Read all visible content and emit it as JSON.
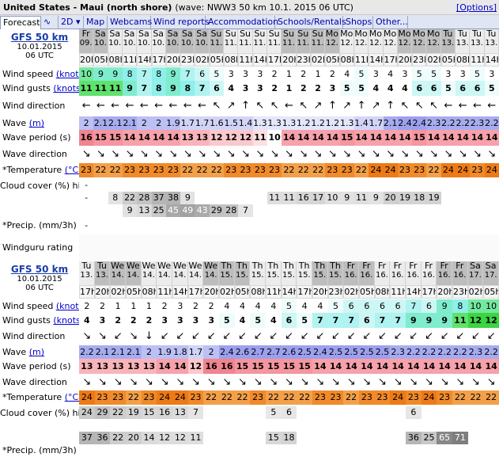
{
  "title": {
    "location": "United States - Maui (north shore)",
    "wave_info": "(wave: NWW3 50 km 10.1. 2015 06 UTC)",
    "options": "[Options]"
  },
  "tabs": [
    {
      "label": "Forecast"
    },
    {
      "label": "∿"
    },
    {
      "label": "2D ▾"
    },
    {
      "label": "Map"
    },
    {
      "label": "Webcams"
    },
    {
      "label": "Wind reports"
    },
    {
      "label": "Accommodation"
    },
    {
      "label": "Schools/Rentals"
    },
    {
      "label": "Shops"
    },
    {
      "label": "Other..."
    }
  ],
  "labels": {
    "wind_speed": "Wind speed",
    "wind_gusts": "Wind gusts",
    "knots": "(knots)",
    "wind_direction": "Wind direction",
    "wave": "Wave",
    "m": "(m)",
    "wave_period": "Wave period (s)",
    "wave_direction": "Wave direction",
    "temperature": "*Temperature",
    "celsius": "(°C)",
    "cloud_cover": "Cloud cover (%) high / mid / low",
    "precip": "*Precip. (mm/3h)",
    "rating": "Windguru rating"
  },
  "model": {
    "name": "GFS 50 km",
    "date": "10.01.2015",
    "time": "06 UTC"
  },
  "block1": {
    "days": [
      "Fr",
      "Sa",
      "Sa",
      "Sa",
      "Sa",
      "Sa",
      "Sa",
      "Sa",
      "Sa",
      "Su",
      "Su",
      "Su",
      "Su",
      "Su",
      "Su",
      "Su",
      "Su",
      "Mo",
      "Mo",
      "Mo",
      "Mo",
      "Mo",
      "Mo",
      "Mo",
      "Mo",
      "Tu",
      "Tu",
      "Tu",
      "Tu"
    ],
    "dates": [
      "09.",
      "10.",
      "10.",
      "10.",
      "10.",
      "10.",
      "10.",
      "10.",
      "10.",
      "11.",
      "11.",
      "11.",
      "11.",
      "11.",
      "11.",
      "11.",
      "11.",
      "12.",
      "12.",
      "12.",
      "12.",
      "12.",
      "12.",
      "12.",
      "12.",
      "13.",
      "13.",
      "13.",
      "13."
    ],
    "hours": [
      "20h",
      "05h",
      "08h",
      "11h",
      "14h",
      "17h",
      "20h",
      "23h",
      "02h",
      "05h",
      "08h",
      "11h",
      "14h",
      "17h",
      "20h",
      "23h",
      "02h",
      "05h",
      "08h",
      "11h",
      "14h",
      "17h",
      "20h",
      "23h",
      "02h",
      "05h",
      "08h",
      "11h",
      "14h"
    ],
    "wind_speed": [
      "10",
      "9",
      "9",
      "8",
      "7",
      "8",
      "9",
      "7",
      "6",
      "5",
      "3",
      "3",
      "3",
      "2",
      "1",
      "2",
      "1",
      "2",
      "4",
      "5",
      "3",
      "4",
      "3",
      "5",
      "5",
      "3",
      "3",
      "5",
      "3"
    ],
    "wind_gusts": [
      "11",
      "11",
      "11",
      "9",
      "7",
      "8",
      "9",
      "8",
      "7",
      "6",
      "4",
      "3",
      "3",
      "2",
      "1",
      "2",
      "2",
      "3",
      "5",
      "5",
      "4",
      "4",
      "4",
      "6",
      "6",
      "5",
      "6",
      "6",
      "5"
    ],
    "wind_dir": [
      "←",
      "←",
      "←",
      "←",
      "←",
      "←",
      "←",
      "←",
      "←",
      "↖",
      "↗",
      "↑",
      "↖",
      "↖",
      "←",
      "↖",
      "↗",
      "↑",
      "↗",
      "↑",
      "↗",
      "↑",
      "↖",
      "↖",
      "↖",
      "←",
      "←",
      "←",
      "←"
    ],
    "wave": [
      "2",
      "2.1",
      "2.1",
      "2.1",
      "2",
      "2",
      "1.9",
      "1.7",
      "1.7",
      "1.6",
      "1.5",
      "1.4",
      "1.3",
      "1.3",
      "1.3",
      "1.2",
      "1.2",
      "1.2",
      "1.3",
      "1.4",
      "1.7",
      "2.1",
      "2.4",
      "2.4",
      "2.3",
      "2.2",
      "2.2",
      "2.3",
      "2.2"
    ],
    "wave_period": [
      "16",
      "15",
      "15",
      "14",
      "14",
      "14",
      "14",
      "13",
      "13",
      "12",
      "12",
      "12",
      "11",
      "10",
      "14",
      "14",
      "14",
      "14",
      "15",
      "14",
      "14",
      "14",
      "14",
      "15",
      "14",
      "14",
      "14",
      "14",
      "14"
    ],
    "wave_dir": [
      "↘",
      "↘",
      "↘",
      "↘",
      "↘",
      "↘",
      "↘",
      "↘",
      "↘",
      "↘",
      "↘",
      "↘",
      "↘",
      "↘",
      "↘",
      "↘",
      "↘",
      "↘",
      "↘",
      "↘",
      "↘",
      "↘",
      "↘",
      "↘",
      "↘",
      "↘",
      "↘",
      "↘",
      "↘"
    ],
    "temp": [
      "23",
      "22",
      "22",
      "23",
      "23",
      "23",
      "23",
      "22",
      "22",
      "22",
      "23",
      "23",
      "23",
      "23",
      "22",
      "22",
      "22",
      "23",
      "23",
      "22",
      "24",
      "24",
      "23",
      "23",
      "22",
      "24",
      "24",
      "23",
      "24"
    ],
    "cloud_high": [
      "-",
      "",
      "",
      "",
      "",
      "",
      "",
      "",
      "",
      "",
      "",
      "",
      "",
      "",
      "",
      "",
      "",
      "",
      "",
      "",
      "",
      "",
      "",
      "",
      "",
      "",
      "",
      "",
      ""
    ],
    "cloud_mid": [
      "-",
      "",
      "8",
      "22",
      "28",
      "37",
      "38",
      "9",
      "",
      "",
      "",
      "",
      "",
      "11",
      "11",
      "16",
      "17",
      "10",
      "9",
      "11",
      "9",
      "20",
      "19",
      "18",
      "19",
      "",
      "",
      "",
      ""
    ],
    "cloud_low": [
      "",
      "",
      "",
      "9",
      "13",
      "25",
      "45",
      "49",
      "43",
      "29",
      "28",
      "7",
      "",
      "",
      "",
      "",
      "",
      "",
      "",
      "",
      "",
      "",
      "",
      "",
      "",
      "",
      "",
      "",
      ""
    ],
    "precip": [
      "-",
      "",
      "",
      "",
      "",
      "",
      "",
      "",
      "",
      "",
      "",
      "",
      "",
      "",
      "",
      "",
      "",
      "",
      "",
      "",
      "",
      "",
      "",
      "",
      "",
      "",
      "",
      "",
      ""
    ]
  },
  "block2": {
    "days": [
      "Tu",
      "Tu",
      "We",
      "We",
      "We",
      "We",
      "We",
      "We",
      "We",
      "Th",
      "Th",
      "Th",
      "Th",
      "Th",
      "Th",
      "Th",
      "Th",
      "Fr",
      "Fr",
      "Fr",
      "Fr",
      "Fr",
      "Fr",
      "Fr",
      "Fr",
      "Sa",
      "Sa"
    ],
    "dates": [
      "13.",
      "13.",
      "14.",
      "14.",
      "14.",
      "14.",
      "14.",
      "14.",
      "14.",
      "15.",
      "15.",
      "15.",
      "15.",
      "15.",
      "15.",
      "15.",
      "15.",
      "16.",
      "16.",
      "16.",
      "16.",
      "16.",
      "16.",
      "16.",
      "16.",
      "17.",
      "17."
    ],
    "hours": [
      "17h",
      "20h",
      "02h",
      "05h",
      "08h",
      "11h",
      "14h",
      "17h",
      "20h",
      "02h",
      "05h",
      "08h",
      "11h",
      "14h",
      "17h",
      "20h",
      "23h",
      "02h",
      "05h",
      "08h",
      "11h",
      "14h",
      "17h",
      "20h",
      "23h",
      "02h",
      "05h"
    ],
    "wind_speed": [
      "2",
      "2",
      "1",
      "1",
      "1",
      "2",
      "3",
      "2",
      "2",
      "4",
      "4",
      "4",
      "4",
      "5",
      "4",
      "4",
      "5",
      "6",
      "6",
      "6",
      "6",
      "7",
      "6",
      "9",
      "8",
      "10",
      "10"
    ],
    "wind_gusts": [
      "4",
      "3",
      "2",
      "2",
      "2",
      "3",
      "3",
      "3",
      "3",
      "5",
      "4",
      "5",
      "4",
      "6",
      "5",
      "7",
      "7",
      "7",
      "6",
      "7",
      "7",
      "9",
      "9",
      "9",
      "11",
      "12",
      "12"
    ],
    "wind_dir": [
      "↘",
      "↘",
      "↙",
      "↘",
      "↓",
      "↙",
      "↙",
      "↙",
      "↙",
      "↙",
      "↙",
      "↙",
      "↙",
      "↙",
      "↙",
      "↙",
      "↙",
      "↙",
      "↙",
      "↙",
      "↙",
      "↙",
      "↙",
      "↙",
      "↙",
      "↙",
      "↙"
    ],
    "wave": [
      "2.2",
      "2.1",
      "2.1",
      "2.1",
      "2",
      "1.9",
      "1.8",
      "1.7",
      "2",
      "2.4",
      "2.6",
      "2.7",
      "2.7",
      "2.6",
      "2.5",
      "2.4",
      "2.5",
      "2.5",
      "2.5",
      "2.5",
      "2.3",
      "2.2",
      "2.2",
      "2.2",
      "2.2",
      "2.3",
      "2.2"
    ],
    "wave_period": [
      "13",
      "13",
      "13",
      "13",
      "13",
      "14",
      "14",
      "12",
      "16",
      "16",
      "15",
      "15",
      "15",
      "15",
      "15",
      "14",
      "14",
      "14",
      "14",
      "14",
      "14",
      "14",
      "14",
      "14",
      "14",
      "14",
      "14"
    ],
    "wave_dir": [
      "↘",
      "↘",
      "↘",
      "↘",
      "↘",
      "↘",
      "↘",
      "↘",
      "↘",
      "↘",
      "↘",
      "↘",
      "↘",
      "↘",
      "↘",
      "↘",
      "↘",
      "↘",
      "↘",
      "↘",
      "↘",
      "↘",
      "↘",
      "↘",
      "↘",
      "↘",
      "↘"
    ],
    "temp": [
      "24",
      "23",
      "23",
      "22",
      "23",
      "24",
      "24",
      "23",
      "22",
      "22",
      "22",
      "23",
      "22",
      "22",
      "22",
      "23",
      "23",
      "22",
      "23",
      "23",
      "24",
      "23",
      "24",
      "23",
      "22",
      "22",
      "22"
    ],
    "cloud_high": [
      "24",
      "29",
      "22",
      "19",
      "15",
      "16",
      "13",
      "7",
      "",
      "",
      "",
      "",
      "5",
      "6",
      "",
      "",
      "",
      "",
      "",
      "",
      "",
      "6",
      "",
      "",
      "",
      "",
      ""
    ],
    "cloud_mid": [
      "",
      "",
      "",
      "",
      "",
      "",
      "",
      "",
      "",
      "",
      "",
      "",
      "",
      "",
      "",
      "",
      "",
      "",
      "",
      "",
      "",
      "",
      "",
      "",
      "",
      "",
      ""
    ],
    "cloud_low": [
      "37",
      "36",
      "22",
      "20",
      "14",
      "12",
      "12",
      "11",
      "",
      "",
      "",
      "",
      "15",
      "18",
      "",
      "",
      "",
      "",
      "",
      "",
      "",
      "36",
      "25",
      "65",
      "71",
      "",
      ""
    ],
    "precip": [
      "",
      "",
      "",
      "",
      "",
      "",
      "",
      "",
      "",
      "",
      "",
      "",
      "",
      "",
      "",
      "",
      "",
      "",
      "",
      "",
      "",
      "",
      "",
      "",
      "",
      "",
      ""
    ]
  }
}
